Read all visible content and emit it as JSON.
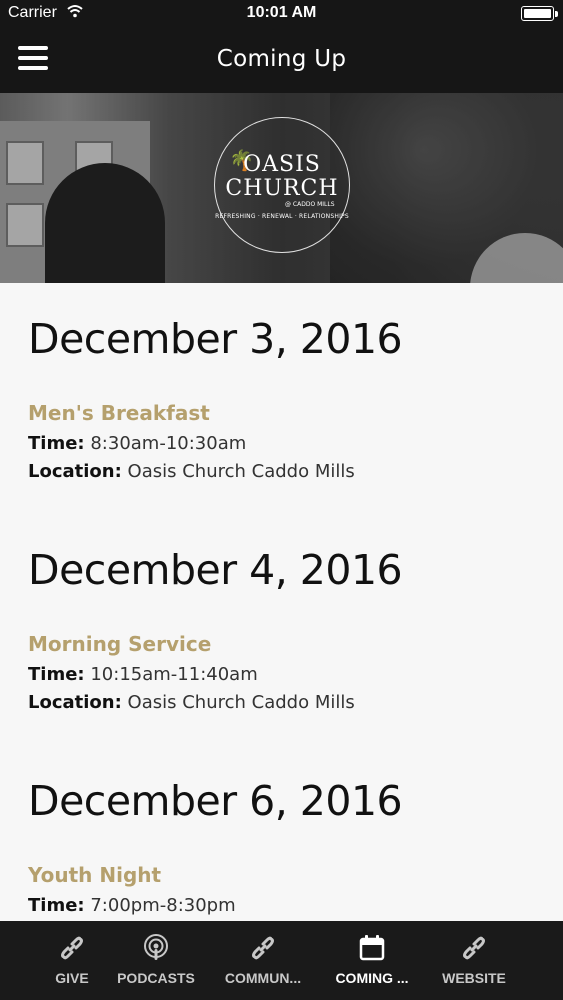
{
  "status_bar": {
    "carrier": "Carrier",
    "time": "10:01 AM"
  },
  "header": {
    "title": "Coming Up"
  },
  "hero": {
    "logo_line1": "OASIS",
    "logo_line2": "CHURCH",
    "logo_sub": "@ CADDO MILLS",
    "logo_tagline": "REFRESHING · RENEWAL · RELATIONSHIPS"
  },
  "events": [
    {
      "date": "December 3, 2016",
      "title": "Men's Breakfast",
      "time_label": "Time:",
      "time": "8:30am-10:30am",
      "location_label": "Location:",
      "location": "Oasis Church Caddo Mills"
    },
    {
      "date": "December 4, 2016",
      "title": "Morning Service",
      "time_label": "Time:",
      "time": "10:15am-11:40am",
      "location_label": "Location:",
      "location": "Oasis Church Caddo Mills"
    },
    {
      "date": "December 6, 2016",
      "title": "Youth Night",
      "time_label": "Time:",
      "time": "7:00pm-8:30pm"
    }
  ],
  "tabs": [
    {
      "label": "GIVE",
      "icon": "link-icon"
    },
    {
      "label": "PODCASTS",
      "icon": "podcast-icon"
    },
    {
      "label": "COMMUN...",
      "icon": "link-icon"
    },
    {
      "label": "COMING ...",
      "icon": "calendar-icon",
      "active": true
    },
    {
      "label": "WEBSITE",
      "icon": "link-icon"
    }
  ],
  "colors": {
    "accent": "#b5a06d",
    "bar": "#161616"
  }
}
